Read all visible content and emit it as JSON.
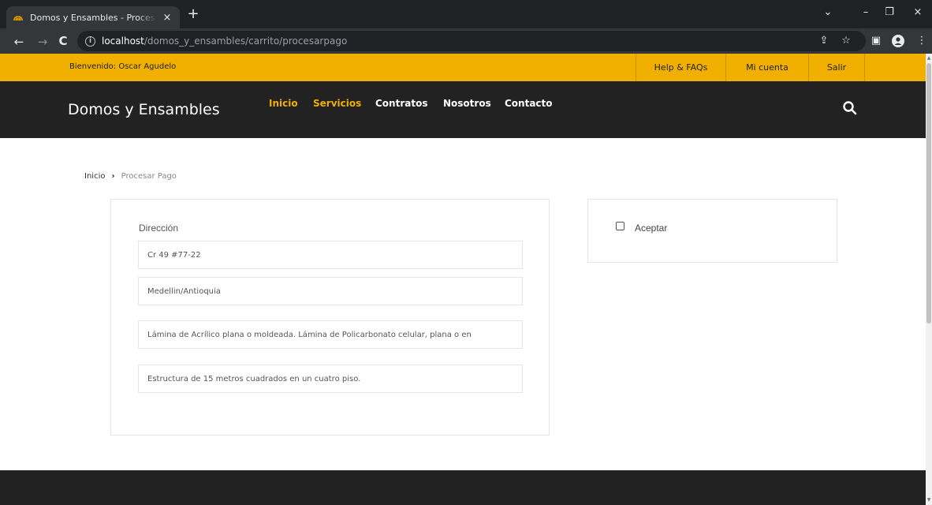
{
  "browser": {
    "tab_title": "Domos y Ensambles - Procesar Pago",
    "tab_close": "×",
    "new_tab": "+",
    "url_host": "localhost",
    "url_path": "/domos_y_ensambles/carrito/procesarpago",
    "controls": {
      "dropdown": "⌄",
      "minimize": "–",
      "restore": "❐",
      "close": "×"
    }
  },
  "topbar": {
    "welcome": "Bienvenido: Oscar Agudelo",
    "links": [
      "Help & FAQs",
      "Mi cuenta",
      "Salir"
    ]
  },
  "header": {
    "brand": "Domos y Ensambles",
    "menu": [
      "Inicio",
      "Servicios",
      "Contratos",
      "Nosotros",
      "Contacto"
    ]
  },
  "breadcrumb": {
    "home": "Inicio",
    "separator": "›",
    "current": "Procesar Pago"
  },
  "form": {
    "label": "Dirección",
    "address": "Cr 49 #77-22",
    "city": "Medellin/Antioquia",
    "description": "Lámina de Acrílico plana o moldeada. Lámina de Policarbonato celular, plana o en",
    "details": "Estructura de 15 metros cuadrados en un cuatro piso."
  },
  "side": {
    "checkbox_label": "Aceptar",
    "checked": false
  },
  "colors": {
    "accent": "#f1af00",
    "header_bg": "#222222",
    "chrome_bg": "#202124"
  },
  "icons": [
    "info-icon",
    "search-icon",
    "back-icon",
    "forward-icon",
    "reload-icon",
    "share-icon",
    "star-icon",
    "sidepanel-icon",
    "profile-icon",
    "menu-icon"
  ]
}
